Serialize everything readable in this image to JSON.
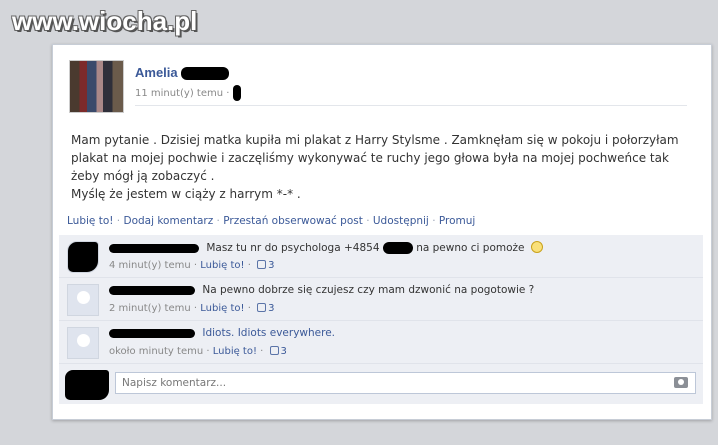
{
  "watermark": "www.wiocha.pl",
  "post": {
    "author": "Amelia",
    "time": "11 minut(y) temu",
    "text_lines": [
      "Mam pytanie . Dzisiej matka kupiła mi plakat z Harry Stylsme . Zamknęłam się w pokoju i połorzyłam",
      "plakat na mojej pochwie i zaczęliśmy wykonywać te ruchy jego głowa była na mojej pochweńce tak",
      "żeby mógł ją zobaczyć .",
      "Myślę że jestem w ciąży z harrym *-* ."
    ],
    "actions": [
      "Lubię to!",
      "Dodaj komentarz",
      "Przestań obserwować post",
      "Udostępnij",
      "Promuj"
    ]
  },
  "comments": [
    {
      "text_a": "Masz tu nr do psychologa +4854",
      "text_b": "na pewno ci pomoże",
      "time": "4 minut(y) temu",
      "like": "Lubię to!",
      "count": "3"
    },
    {
      "text_a": "Na pewno dobrze się czujesz czy mam dzwonić na pogotowie ?",
      "time": "2 minut(y) temu",
      "like": "Lubię to!",
      "count": "3"
    },
    {
      "text_a": "Idiots. Idiots everywhere.",
      "time": "około minuty temu",
      "like": "Lubię to!",
      "count": "3"
    }
  ],
  "write_comment": {
    "placeholder": "Napisz komentarz..."
  }
}
